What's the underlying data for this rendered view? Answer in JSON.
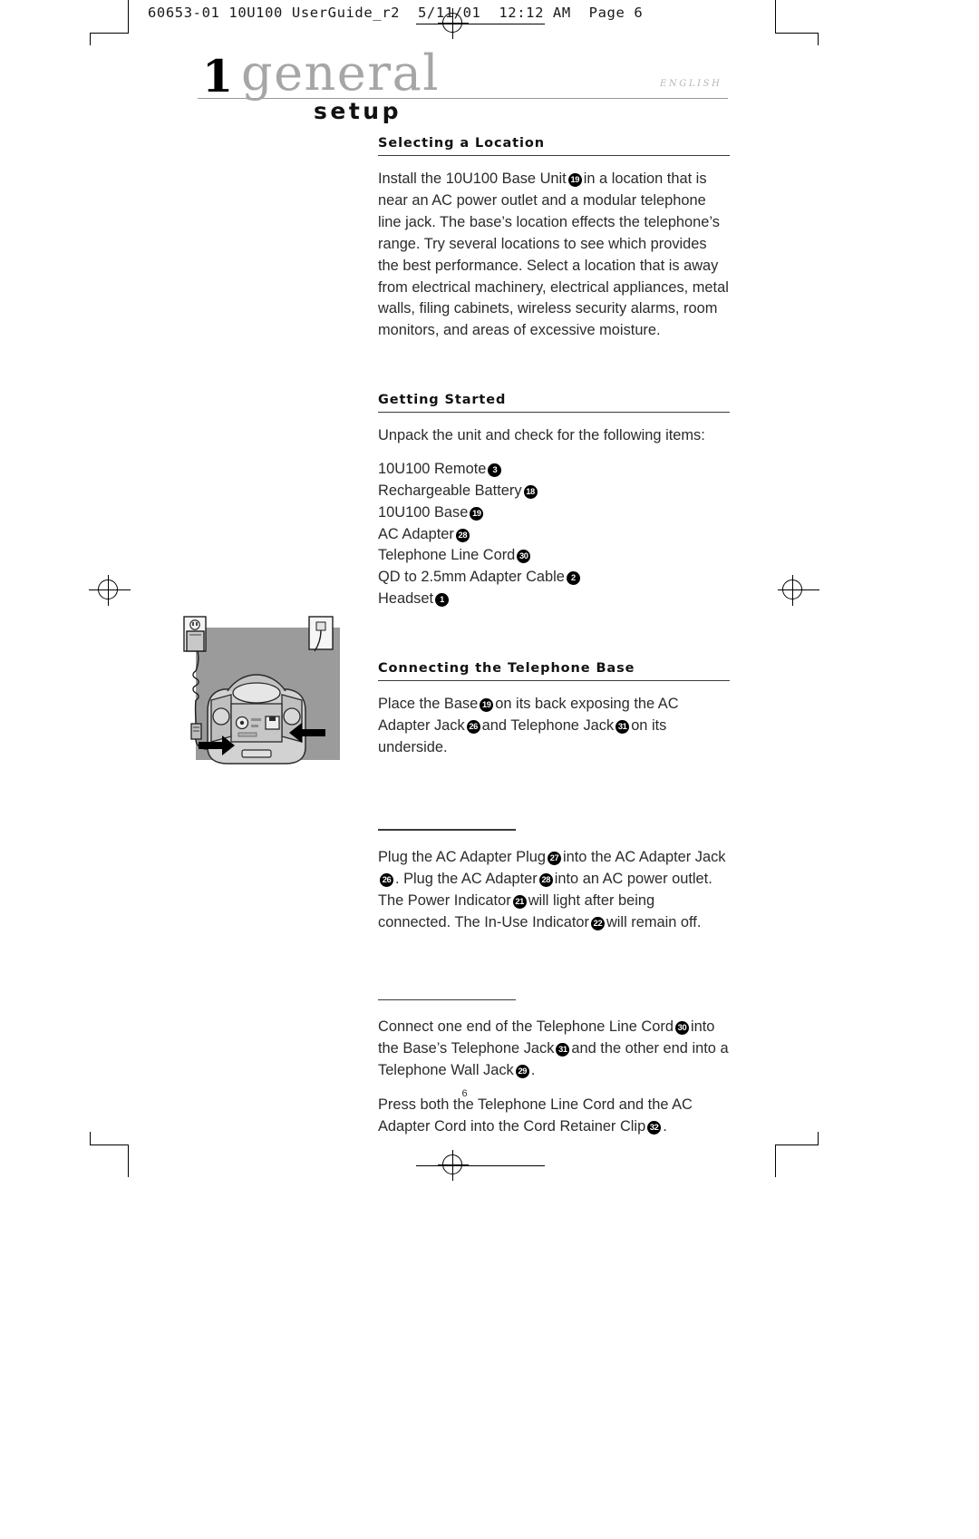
{
  "slug": "60653-01 10U100 UserGuide_r2  5/11/01  12:12 AM  Page 6",
  "title": {
    "number": "1",
    "word": "general",
    "subtitle": "setup",
    "language": "ENGLISH"
  },
  "page_number": "6",
  "sections": [
    {
      "heading": "Selecting a Location",
      "paragraph": "Install the 10U100 Base Unit ⑲ in a location that is near an AC power outlet and a modular telephone line jack. The base's location effects the telephone's range. Try several locations to see which provides the best performance. Select a location that is away from electrical machinery, electrical appliances, metal walls, filing cabinets, wireless security alarms, room monitors, and areas of excessive moisture."
    },
    {
      "heading": "Getting Started",
      "paragraph": "Unpack the unit and check for the following items:"
    },
    {
      "heading": "Connecting the Telephone Base",
      "paragraph": "Place the Base ⑲ on its back exposing the AC Adapter Jack ㉖ and Telephone Jack ㉛ on its underside."
    }
  ],
  "location": {
    "heading": "Selecting a Location",
    "text_a": "Install the 10U100 Base Unit",
    "badge_1": "19",
    "text_b": "in a location that is near an AC power outlet and a modular telephone line jack. The base’s location effects the telephone’s range. Try several locations to see which provides the best performance. Select a location that is away from electrical machinery, electrical appliances, metal walls, filing cabinets, wireless security alarms, room monitors, and areas of excessive moisture."
  },
  "getting_started": {
    "heading": "Getting Started",
    "intro": "Unpack the unit and check for the following items:",
    "items": [
      {
        "label": "10U100 Remote",
        "badge": "3"
      },
      {
        "label": "Rechargeable Battery",
        "badge": "18"
      },
      {
        "label": "10U100 Base",
        "badge": "19"
      },
      {
        "label": "AC Adapter",
        "badge": "28"
      },
      {
        "label": "Telephone Line Cord",
        "badge": "30"
      },
      {
        "label": "QD to 2.5mm Adapter Cable",
        "badge": "2"
      },
      {
        "label": "Headset",
        "badge": "1"
      }
    ]
  },
  "connecting": {
    "heading": "Connecting the Telephone Base",
    "p1_a": "Place the Base",
    "p1_badge1": "19",
    "p1_b": "on its back exposing the AC Adapter Jack",
    "p1_badge2": "26",
    "p1_c": "and Telephone Jack",
    "p1_badge3": "31",
    "p1_d": "on its underside.",
    "p2_a": "Plug the AC Adapter Plug",
    "p2_badge1": "27",
    "p2_b": "into the AC Adapter Jack",
    "p2_badge2": "26",
    "p2_c": ". Plug the AC Adapter",
    "p2_badge3": "28",
    "p2_d": "into an AC power outlet. The Power Indicator",
    "p2_badge4": "21",
    "p2_e": "will light after being connected. The In-Use Indicator",
    "p2_badge5": "22",
    "p2_f": "will remain off.",
    "p3_a": "Connect one end of the Telephone Line Cord",
    "p3_badge1": "30",
    "p3_b": "into the Base’s Telephone Jack",
    "p3_badge2": "31",
    "p3_c": "and the other end into a Telephone Wall Jack",
    "p3_badge3": "29",
    "p3_d": ".",
    "p4_a": "Press both the Telephone Line Cord and the AC Adapter Cord into the Cord Retainer Clip",
    "p4_badge1": "32",
    "p4_b": "."
  },
  "figure": {
    "name": "telephone-base-underside-illustration",
    "background_color": "#9b9b9b"
  }
}
